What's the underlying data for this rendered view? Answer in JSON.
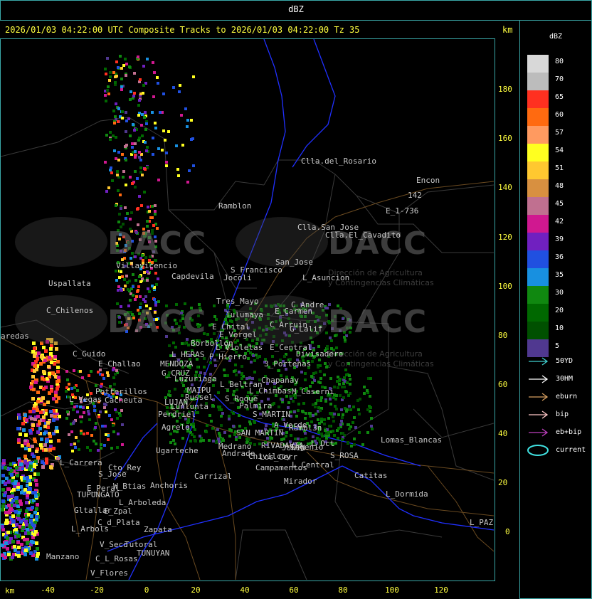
{
  "window": {
    "title": "dBZ"
  },
  "header": {
    "text": "2026/01/03 04:22:00 UTC Composite Tracks to 2026/01/03 04:22:00 Tz 35",
    "km_label": "km"
  },
  "axes": {
    "y_ticks": [
      "180",
      "160",
      "140",
      "120",
      "100",
      "80",
      "60",
      "40",
      "20",
      "0"
    ],
    "x_ticks": [
      "-40",
      "-20",
      "0",
      "20",
      "40",
      "60",
      "80",
      "100",
      "120"
    ],
    "km_label": "km"
  },
  "colorbar": {
    "unit": "dBZ",
    "levels": [
      {
        "value": "80",
        "color": "#d8d8d8"
      },
      {
        "value": "70",
        "color": "#bcbcbc"
      },
      {
        "value": "65",
        "color": "#ff3020"
      },
      {
        "value": "60",
        "color": "#ff6a10"
      },
      {
        "value": "57",
        "color": "#ff9a60"
      },
      {
        "value": "54",
        "color": "#ffff20"
      },
      {
        "value": "51",
        "color": "#ffc830"
      },
      {
        "value": "48",
        "color": "#d89040"
      },
      {
        "value": "45",
        "color": "#c07090"
      },
      {
        "value": "42",
        "color": "#d01890"
      },
      {
        "value": "39",
        "color": "#7020c0"
      },
      {
        "value": "36",
        "color": "#2050e0"
      },
      {
        "value": "35",
        "color": "#1890e0"
      },
      {
        "value": "30",
        "color": "#108810"
      },
      {
        "value": "20",
        "color": "#006800"
      },
      {
        "value": "10",
        "color": "#005000"
      },
      {
        "value": "5",
        "color": "#503890"
      }
    ]
  },
  "track_legend": [
    {
      "label": "50YD",
      "color": "#40d0d0",
      "icon": "arrow-icon"
    },
    {
      "label": "30HM",
      "color": "#ffffff",
      "icon": "arrow-icon"
    },
    {
      "label": "eburn",
      "color": "#d8a060",
      "icon": "arrow-icon"
    },
    {
      "label": "bip",
      "color": "#ffc8c8",
      "icon": "arrow-icon"
    },
    {
      "label": "eb+bip",
      "color": "#c040c0",
      "icon": "arrow-icon"
    },
    {
      "label": "current",
      "color": "#40e0e0",
      "icon": "ellipse-icon"
    }
  ],
  "watermark": {
    "name": "DACC",
    "line1": "Dirección de Agricultura",
    "line2": "y Contingencias Climáticas"
  },
  "places": [
    "Clla.del_Rosario",
    "Encon",
    "142",
    "E_1-736",
    "Ramblon",
    "Clla.San_Jose",
    "Clla.El_Cavadito",
    "Uspallata",
    "Villavicencio",
    "Capdevila",
    "S_Francisco",
    "Jocoli",
    "San_Jose",
    "L_Asuncion",
    "C_Chilenos",
    "Tres_Mayo",
    "Tulumaya",
    "C_Andre",
    "E_Carmen",
    "E_Chital",
    "E_Vergel",
    "C_Arruin",
    "G_Lalif",
    "Borbollon",
    "L_Violetas",
    "E_Central",
    "Divisadero",
    "C_Guido",
    "L_HERAS",
    "MENDOZA",
    "G_CRUZ",
    "E_Challao",
    "P_Hierro",
    "3_Porteñas",
    "Luzuriaga",
    "L_Beltran",
    "Chapanay",
    "MAIPU",
    "L_Chimbas",
    "Russel",
    "M_Caserni",
    "Potrerillos",
    "Cacheuta",
    "L_Vegas",
    "LUJAN",
    "Lunlunta",
    "Perdriel",
    "S_Roque",
    "Palmira",
    "S_MARTIN",
    "A_Verde",
    "Rambl3n",
    "Agrelo",
    "SAN_MARTIN",
    "Ugarteche",
    "Medrano",
    "Andrade",
    "RIVADAVIA",
    "JUNIN",
    "Chivilcoy",
    "Ingenio",
    "L_Oct",
    "Carrizal",
    "Lomas_Blancas",
    "L_Carrera",
    "Cto_Rey",
    "S_Jose",
    "Los_Cerr",
    "Campamentos",
    "L_Central",
    "S_ROSA",
    "Catitas",
    "W_Btias",
    "Anchoris",
    "E_Peral",
    "TUPUNGATO",
    "Mirador",
    "L_Dormida",
    "L_Arboleda",
    "Gltallar",
    "E_Zpal",
    "C_d_Plata",
    "Zapata",
    "L_PAZ",
    "L_Arbols",
    "V_Seco",
    "Tutoral",
    "TUNUYAN",
    "Manzano",
    "C_L_Rosas",
    "V_Flores",
    "aredas"
  ]
}
